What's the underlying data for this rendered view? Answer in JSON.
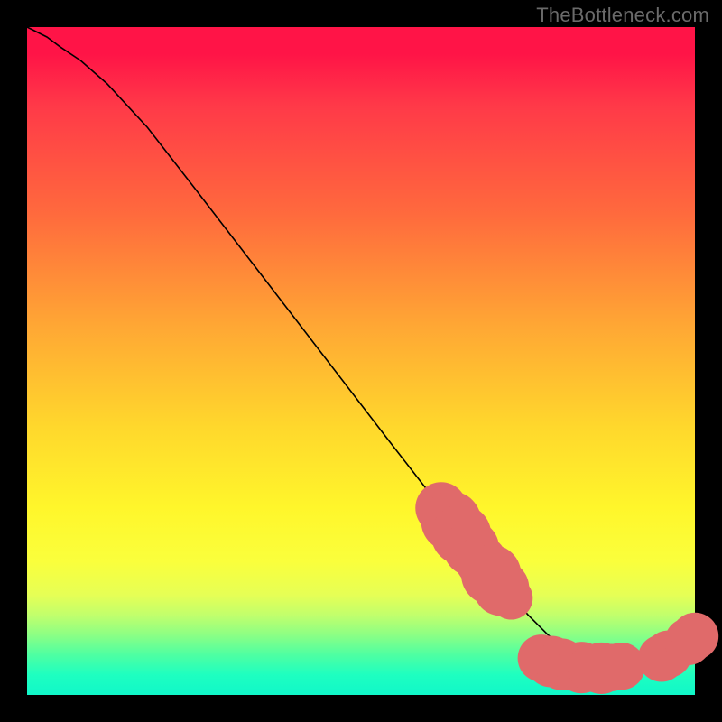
{
  "attribution": "TheBottleneck.com",
  "chart_data": {
    "type": "line",
    "title": "",
    "xlabel": "",
    "ylabel": "",
    "xlim": [
      0,
      100
    ],
    "ylim": [
      0,
      100
    ],
    "grid": false,
    "curve": {
      "x": [
        0,
        3,
        5,
        8,
        12,
        18,
        25,
        35,
        45,
        55,
        62,
        68,
        72,
        75,
        78,
        81,
        84,
        87,
        90,
        93,
        95,
        97,
        99,
        100
      ],
      "y": [
        100,
        98.5,
        97,
        95,
        91.5,
        85,
        76,
        63,
        50,
        37,
        28,
        20.5,
        15.5,
        12,
        9,
        6.5,
        5,
        4.2,
        4,
        4.2,
        5,
        6,
        7.5,
        8.5
      ]
    },
    "markers": {
      "name": "segment-highlight",
      "points": [
        {
          "x": 62,
          "y": 28,
          "r": 2.2
        },
        {
          "x": 63.5,
          "y": 26,
          "r": 2.6
        },
        {
          "x": 65,
          "y": 24,
          "r": 2.6
        },
        {
          "x": 66.5,
          "y": 22,
          "r": 2.4
        },
        {
          "x": 68,
          "y": 20,
          "r": 2.2
        },
        {
          "x": 69.5,
          "y": 18,
          "r": 2.6
        },
        {
          "x": 71,
          "y": 16,
          "r": 2.4
        },
        {
          "x": 72.5,
          "y": 14.5,
          "r": 1.8
        },
        {
          "x": 77,
          "y": 5.5,
          "r": 2.0
        },
        {
          "x": 78.5,
          "y": 5.0,
          "r": 2.2
        },
        {
          "x": 80,
          "y": 4.6,
          "r": 2.2
        },
        {
          "x": 81.5,
          "y": 4.3,
          "r": 2.0
        },
        {
          "x": 83,
          "y": 4.1,
          "r": 2.2
        },
        {
          "x": 84.5,
          "y": 4.0,
          "r": 2.0
        },
        {
          "x": 86,
          "y": 4.0,
          "r": 2.2
        },
        {
          "x": 87.5,
          "y": 4.1,
          "r": 2.0
        },
        {
          "x": 89,
          "y": 4.3,
          "r": 2.0
        },
        {
          "x": 95,
          "y": 5.5,
          "r": 2.0
        },
        {
          "x": 96,
          "y": 6.1,
          "r": 2.0
        },
        {
          "x": 99,
          "y": 8.0,
          "r": 2.0
        },
        {
          "x": 100,
          "y": 8.8,
          "r": 2.0
        }
      ]
    }
  }
}
